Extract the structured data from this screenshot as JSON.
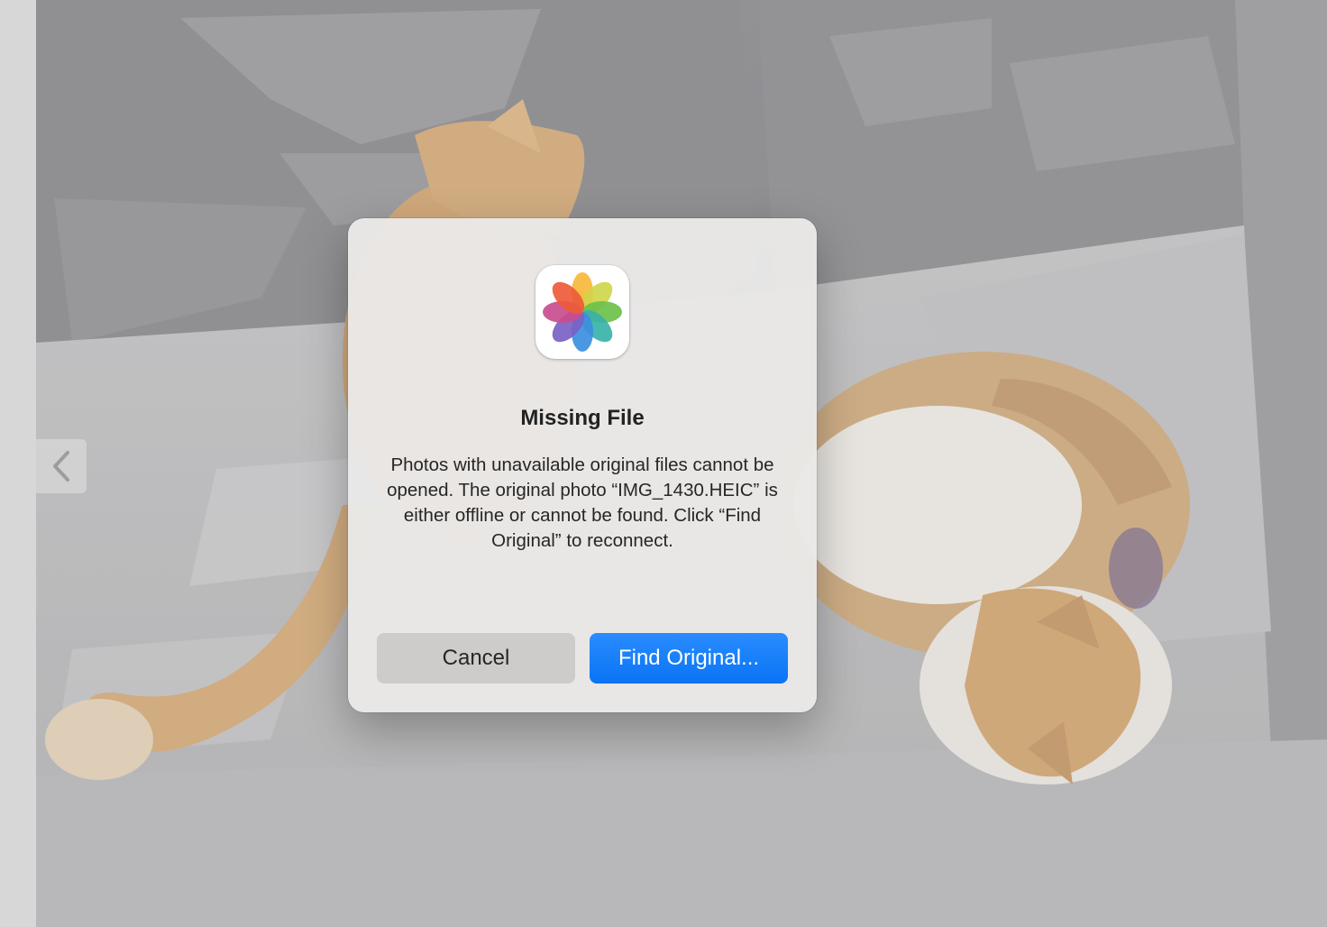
{
  "dialog": {
    "icon": "photos-app-icon",
    "title": "Missing File",
    "message": "Photos with unavailable original files cannot be opened. The original photo “IMG_1430.HEIC” is either offline or cannot be found. Click “Find Original” to reconnect.",
    "cancel_label": "Cancel",
    "confirm_label": "Find Original..."
  },
  "navigation": {
    "previous_icon": "chevron-left-icon"
  },
  "colors": {
    "accent": "#0A74F5",
    "cancel_button": "#CDCCCB",
    "dialog_background": "#E9E8E7"
  }
}
